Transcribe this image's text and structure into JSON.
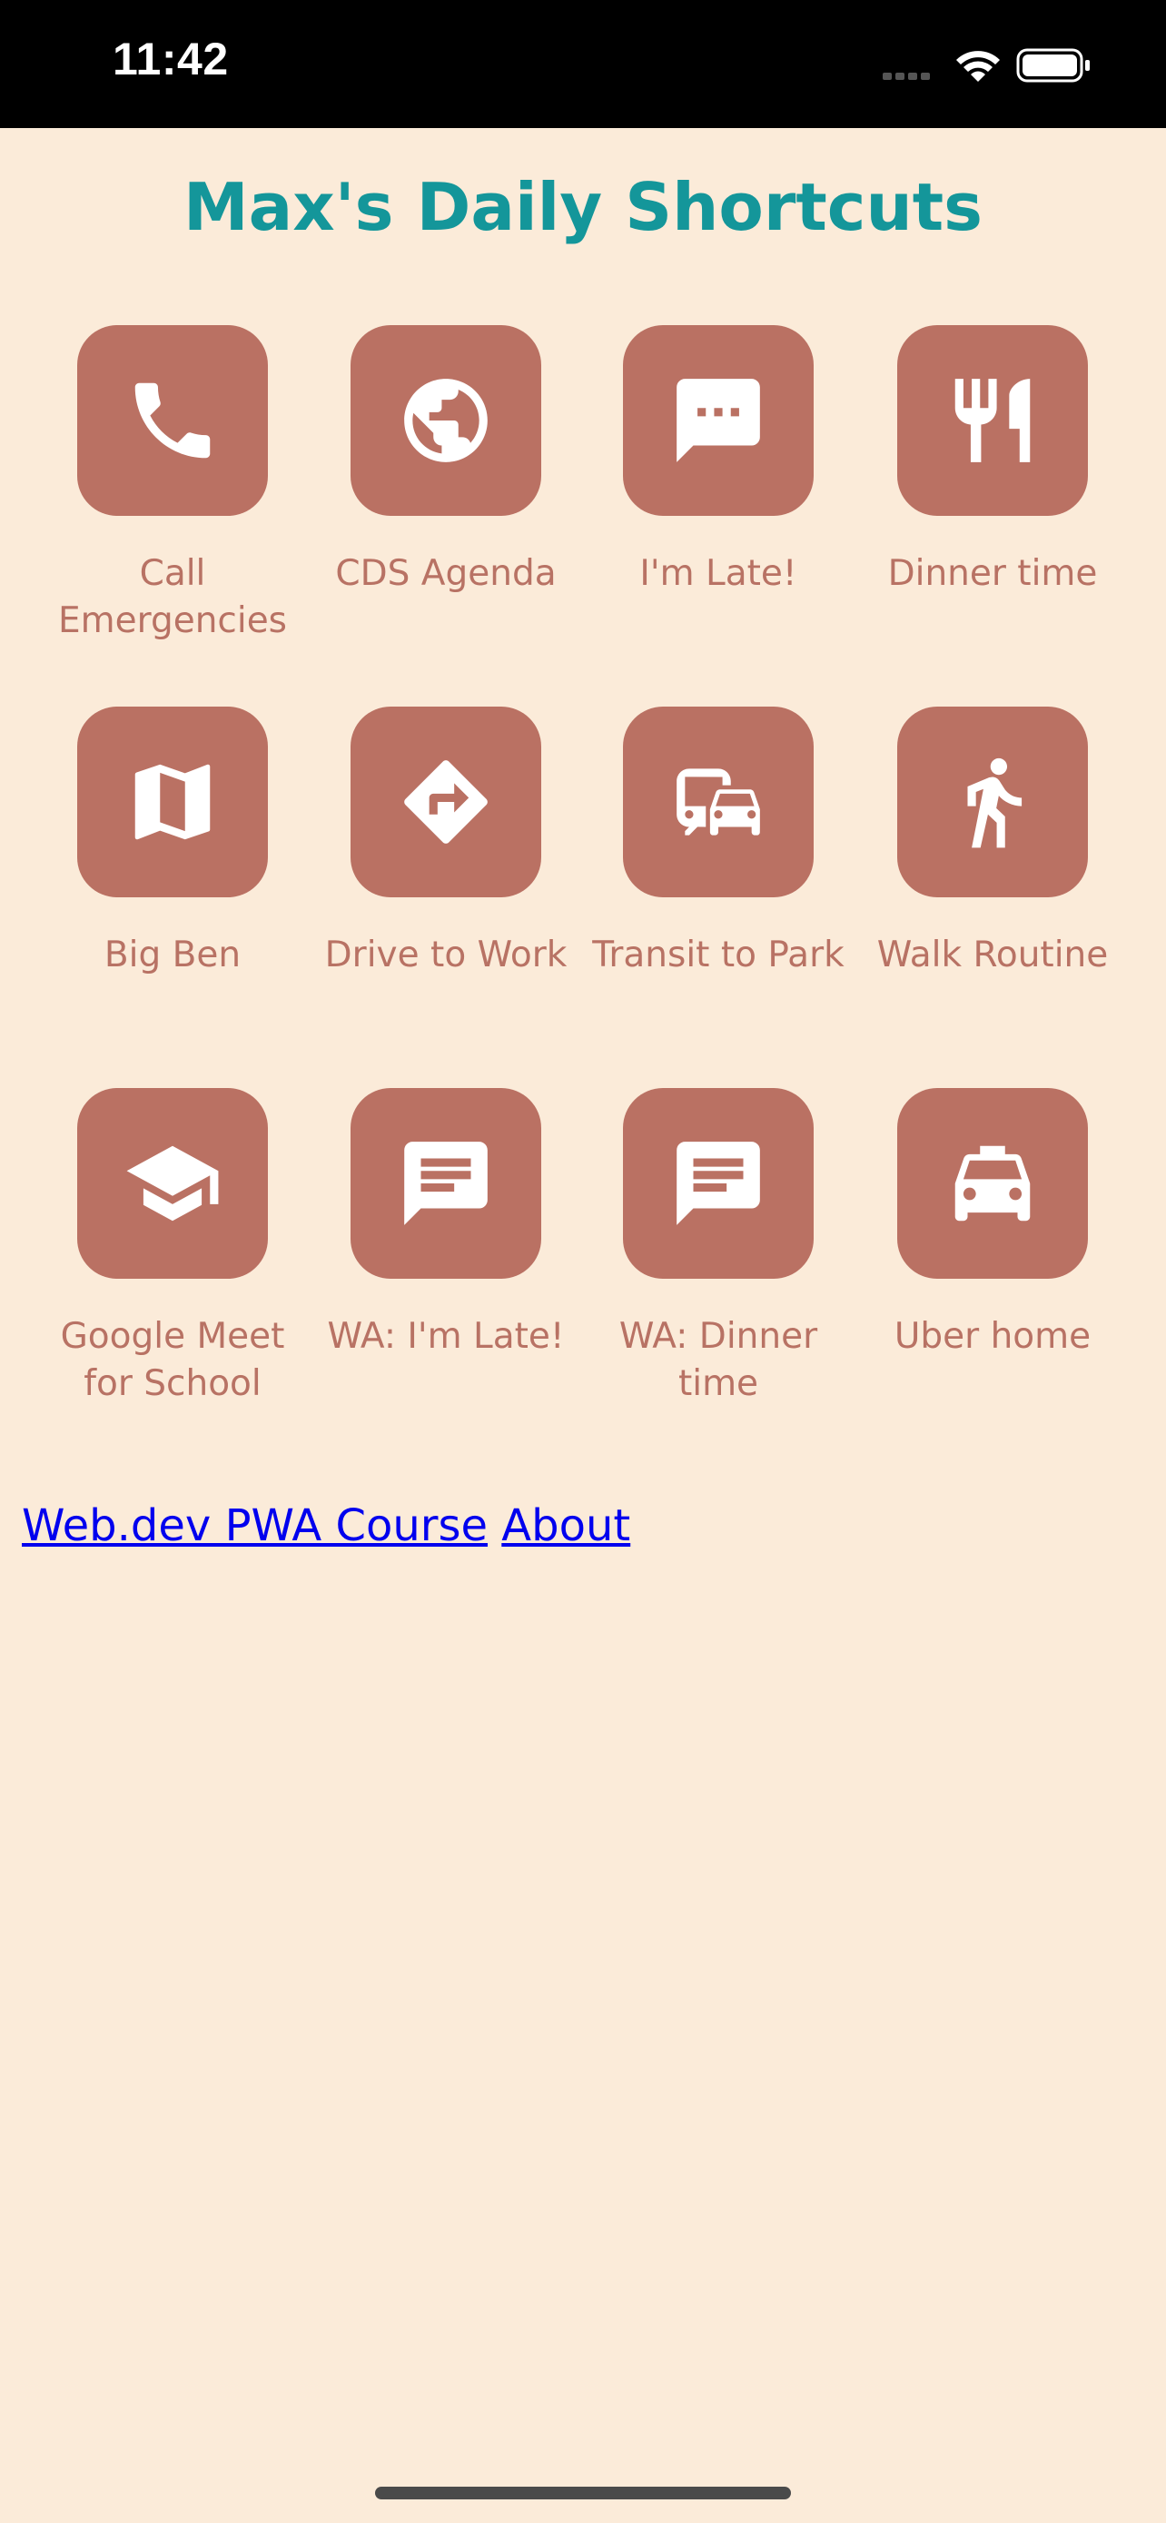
{
  "status_bar": {
    "time": "11:42",
    "icons": [
      "signal-icon",
      "wifi-icon",
      "battery-icon"
    ]
  },
  "page": {
    "title": "Max's Daily Shortcuts"
  },
  "shortcuts": [
    {
      "label": "Call Emergencies",
      "icon": "phone-icon"
    },
    {
      "label": "CDS Agenda",
      "icon": "globe-icon"
    },
    {
      "label": "I'm Late!",
      "icon": "chat-bubble-icon"
    },
    {
      "label": "Dinner time",
      "icon": "restaurant-icon"
    },
    {
      "label": "Big Ben",
      "icon": "map-icon"
    },
    {
      "label": "Drive to Work",
      "icon": "directions-icon"
    },
    {
      "label": "Transit to Park",
      "icon": "commute-icon"
    },
    {
      "label": "Walk Routine",
      "icon": "walking-icon"
    },
    {
      "label": "Google Meet for School",
      "icon": "school-icon"
    },
    {
      "label": "WA: I'm Late!",
      "icon": "message-icon"
    },
    {
      "label": "WA: Dinner time",
      "icon": "message-icon"
    },
    {
      "label": "Uber home",
      "icon": "taxi-icon"
    }
  ],
  "footer_links": [
    {
      "label": "Web.dev PWA Course"
    },
    {
      "label": "About"
    }
  ],
  "colors": {
    "background": "#fbebd9",
    "title": "#14969a",
    "tile": "#ba7163",
    "label": "#b87264",
    "link": "#0000ee"
  }
}
